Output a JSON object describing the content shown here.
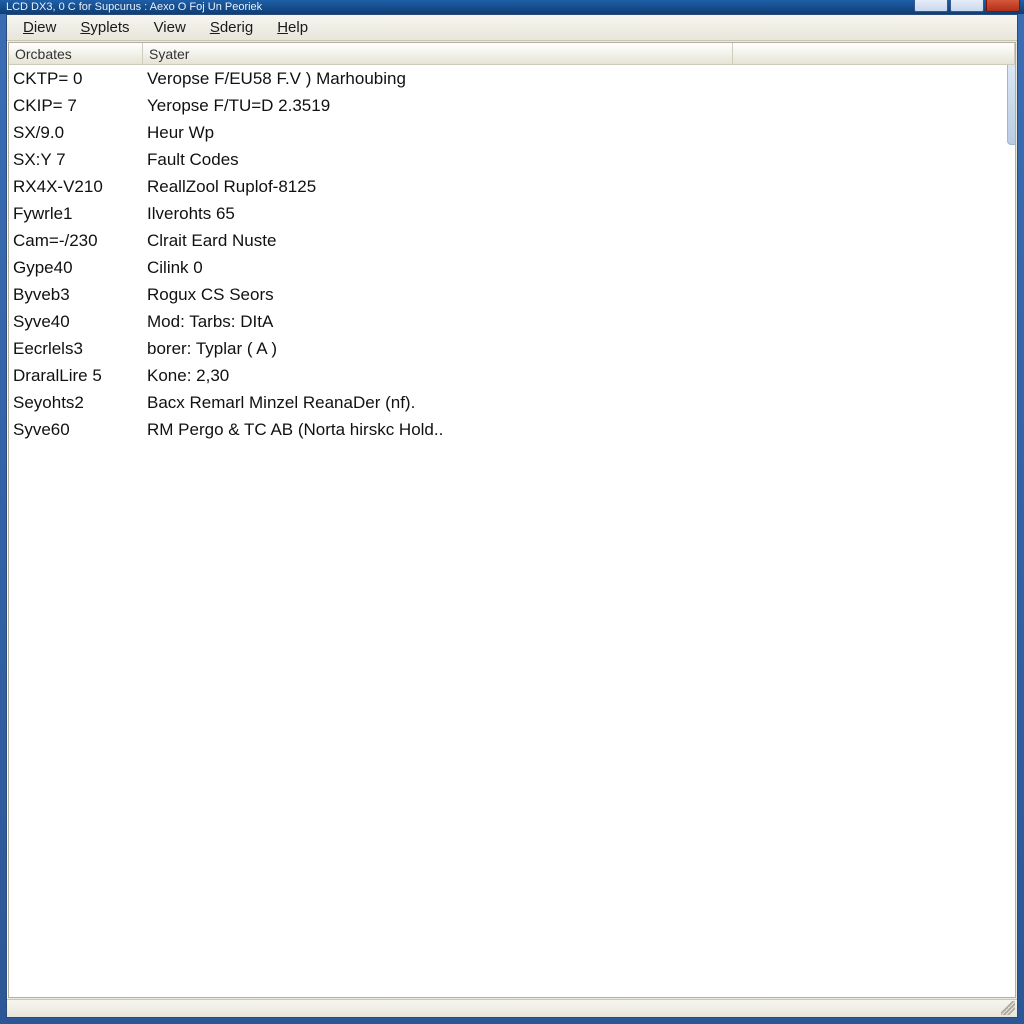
{
  "title": "LCD DX3, 0 C for Supcurus : Aexo O Foj Un Peoriek",
  "menu": {
    "items": [
      {
        "label": "Diew",
        "accel_index": 0
      },
      {
        "label": "Syplets",
        "accel_index": 0
      },
      {
        "label": "View",
        "accel_index": -1
      },
      {
        "label": "Sderig",
        "accel_index": 0
      },
      {
        "label": "Help",
        "accel_index": 0
      }
    ]
  },
  "columns": [
    {
      "label": "Orcbates"
    },
    {
      "label": "Syater"
    },
    {
      "label": ""
    }
  ],
  "rows": [
    {
      "c0": "CKTP= 0",
      "c1": "Veropse F/EU58 F.V ) Marhoubing"
    },
    {
      "c0": "CKIP= 7",
      "c1": "Yeropse F/TU=D 2.3519"
    },
    {
      "c0": "SX/9.0",
      "c1": "Heur Wp"
    },
    {
      "c0": "SX:Y 7",
      "c1": "Fault Codes"
    },
    {
      "c0": "RX4X-V210",
      "c1": "ReallZool Ruplof-8125"
    },
    {
      "c0": "Fywrle1",
      "c1": "Ilverohts 65"
    },
    {
      "c0": "Cam=-/230",
      "c1": "Clrait Eard Nuste"
    },
    {
      "c0": "Gype40",
      "c1": "Cilink 0"
    },
    {
      "c0": "Byveb3",
      "c1": "Rogux CS Seors"
    },
    {
      "c0": "Syve40",
      "c1": "Mod: Tarbs: DItA"
    },
    {
      "c0": "Eecrlels3",
      "c1": "borer: Typlar ( A )"
    },
    {
      "c0": "DraralLire 5",
      "c1": "Kone: 2,30"
    },
    {
      "c0": "Seyohts2",
      "c1": "Bacx Remarl Minzel ReanaDer (nf)."
    },
    {
      "c0": "Syve60",
      "c1": "RM Pergo & TC AB (Norta hirskc Hold.."
    }
  ],
  "caption_buttons": {
    "minimize": "Minimize",
    "maximize": "Maximize",
    "close": "Close"
  }
}
